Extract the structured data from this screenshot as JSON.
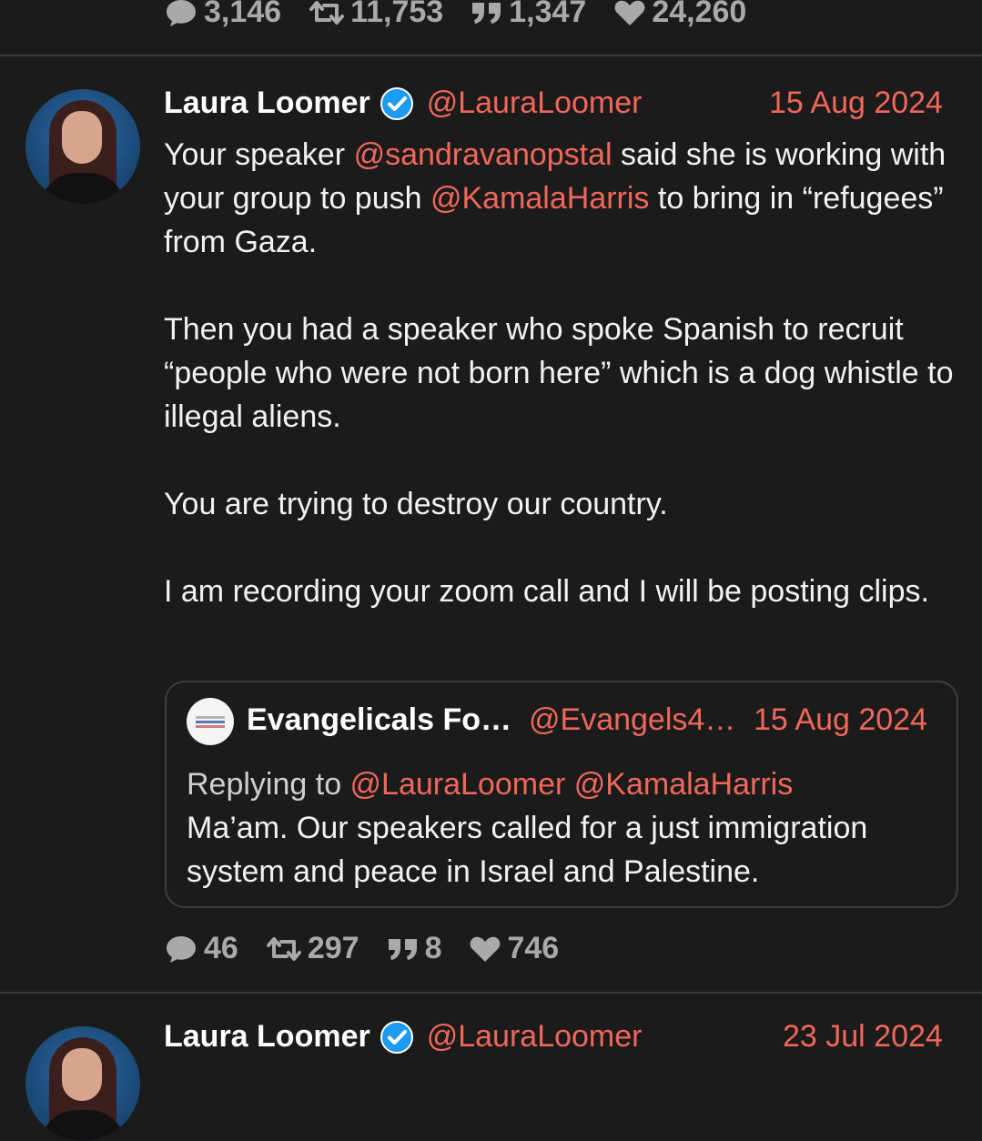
{
  "top_tweet_stats": {
    "replies": "3,146",
    "retweets": "11,753",
    "quotes": "1,347",
    "likes": "24,260"
  },
  "tweet": {
    "author": "Laura Loomer",
    "handle": "@LauraLoomer",
    "date": "15 Aug 2024",
    "p1_a": "Your speaker ",
    "p1_m1": "@sandravanopstal",
    "p1_b": " said she is working with your group to push ",
    "p1_m2": "@KamalaHarris",
    "p1_c": " to bring in “refugees” from Gaza.",
    "p2": "Then you had a speaker who spoke Spanish to recruit “people who were not born here” which is a dog whistle to illegal aliens.",
    "p3": "You are trying to destroy our country.",
    "p4": "I am recording your zoom call and I will be posting clips.",
    "quote": {
      "author": "Evangelicals Fo…",
      "handle": "@Evangels4…",
      "date": "15 Aug 2024",
      "replying_prefix": "Replying to ",
      "replying_to_1": "@LauraLoomer",
      "replying_to_2": "@KamalaHarris",
      "text": "Ma’am. Our speakers called for a just immigration system and peace in Israel and Palestine."
    },
    "stats": {
      "replies": "46",
      "retweets": "297",
      "quotes": "8",
      "likes": "746"
    }
  },
  "next_tweet": {
    "author": "Laura Loomer",
    "handle": "@LauraLoomer",
    "date": "23 Jul 2024"
  },
  "colors": {
    "background": "#1b1b1b",
    "accent": "#f0675a",
    "muted": "#a9a9a9",
    "verified": "#1d9bf0"
  },
  "icons": [
    "reply-icon",
    "retweet-icon",
    "quote-icon",
    "like-icon",
    "verified-badge-icon"
  ]
}
